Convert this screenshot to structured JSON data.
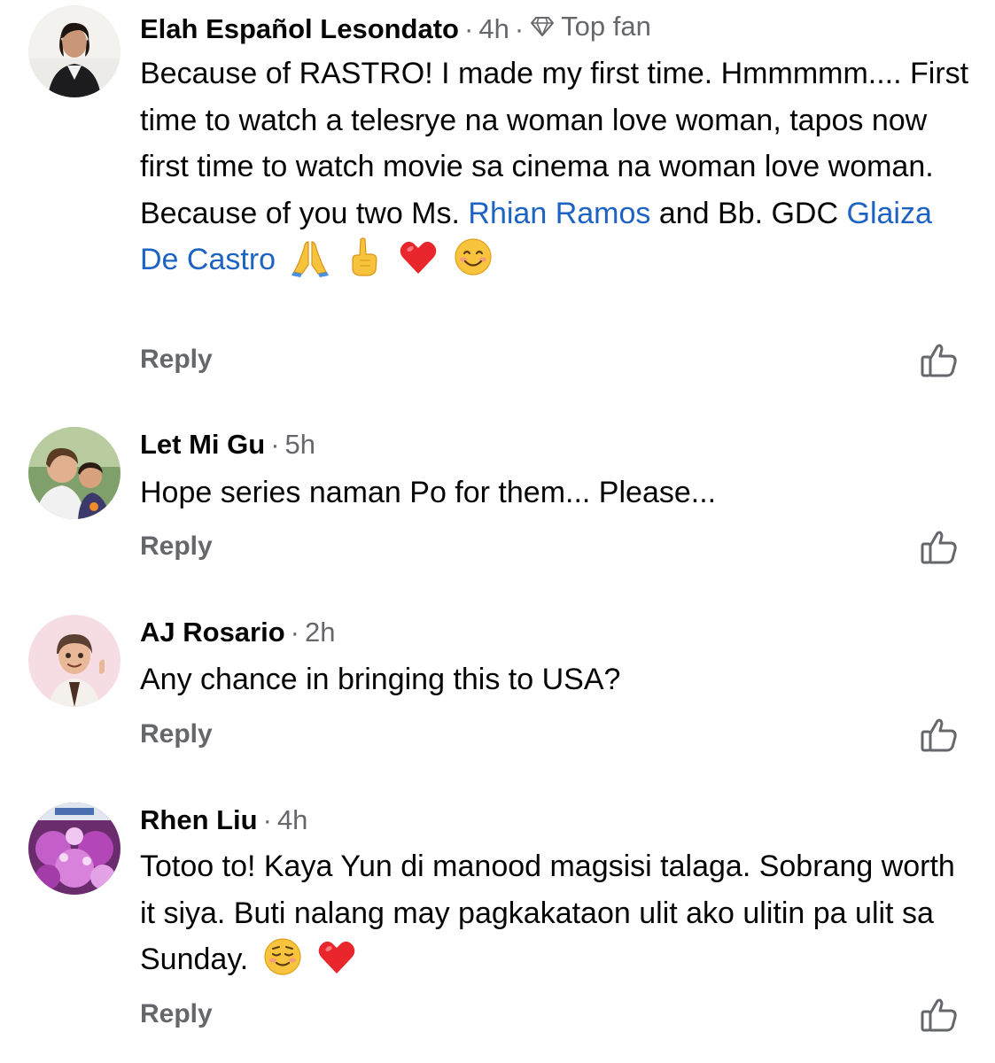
{
  "comments": [
    {
      "name": "Elah Español Lesondato",
      "time": "4h",
      "badge": "Top fan",
      "badge_icon": "diamond-icon",
      "segments": [
        {
          "text": "Because of RASTRO! I made my first time. Hmmmmm.... First time to watch a telesrye na woman love woman, tapos now first time to watch movie sa cinema na woman love woman. Because of you two Ms. "
        },
        {
          "text": "Rhian Ramos",
          "mention": true
        },
        {
          "text": "  and Bb. GDC "
        },
        {
          "text": "Glaiza De Castro",
          "mention": true
        }
      ],
      "emojis": [
        "folded-hands",
        "pointing-up",
        "red-heart",
        "smiling-face"
      ],
      "reply_label": "Reply",
      "like_icon": "thumbs-up-icon"
    },
    {
      "name": "Let Mi Gu",
      "time": "5h",
      "segments": [
        {
          "text": "Hope series naman Po for them... Please..."
        }
      ],
      "emojis": [],
      "reply_label": "Reply",
      "like_icon": "thumbs-up-icon"
    },
    {
      "name": "AJ Rosario",
      "time": "2h",
      "segments": [
        {
          "text": "Any chance in bringing this to USA?"
        }
      ],
      "emojis": [],
      "reply_label": "Reply",
      "like_icon": "thumbs-up-icon"
    },
    {
      "name": "Rhen Liu",
      "time": "4h",
      "segments": [
        {
          "text": "Totoo to! Kaya Yun di manood magsisi talaga. Sobrang worth it siya. Buti nalang may pagkakataon ulit ako ulitin pa ulit sa Sunday."
        }
      ],
      "emojis": [
        "relieved-face",
        "red-heart"
      ],
      "reply_label": "Reply",
      "like_icon": "thumbs-up-icon"
    }
  ],
  "colors": {
    "name": "#050505",
    "meta": "#65676b",
    "mention": "#1d63c4",
    "background": "#ffffff"
  }
}
